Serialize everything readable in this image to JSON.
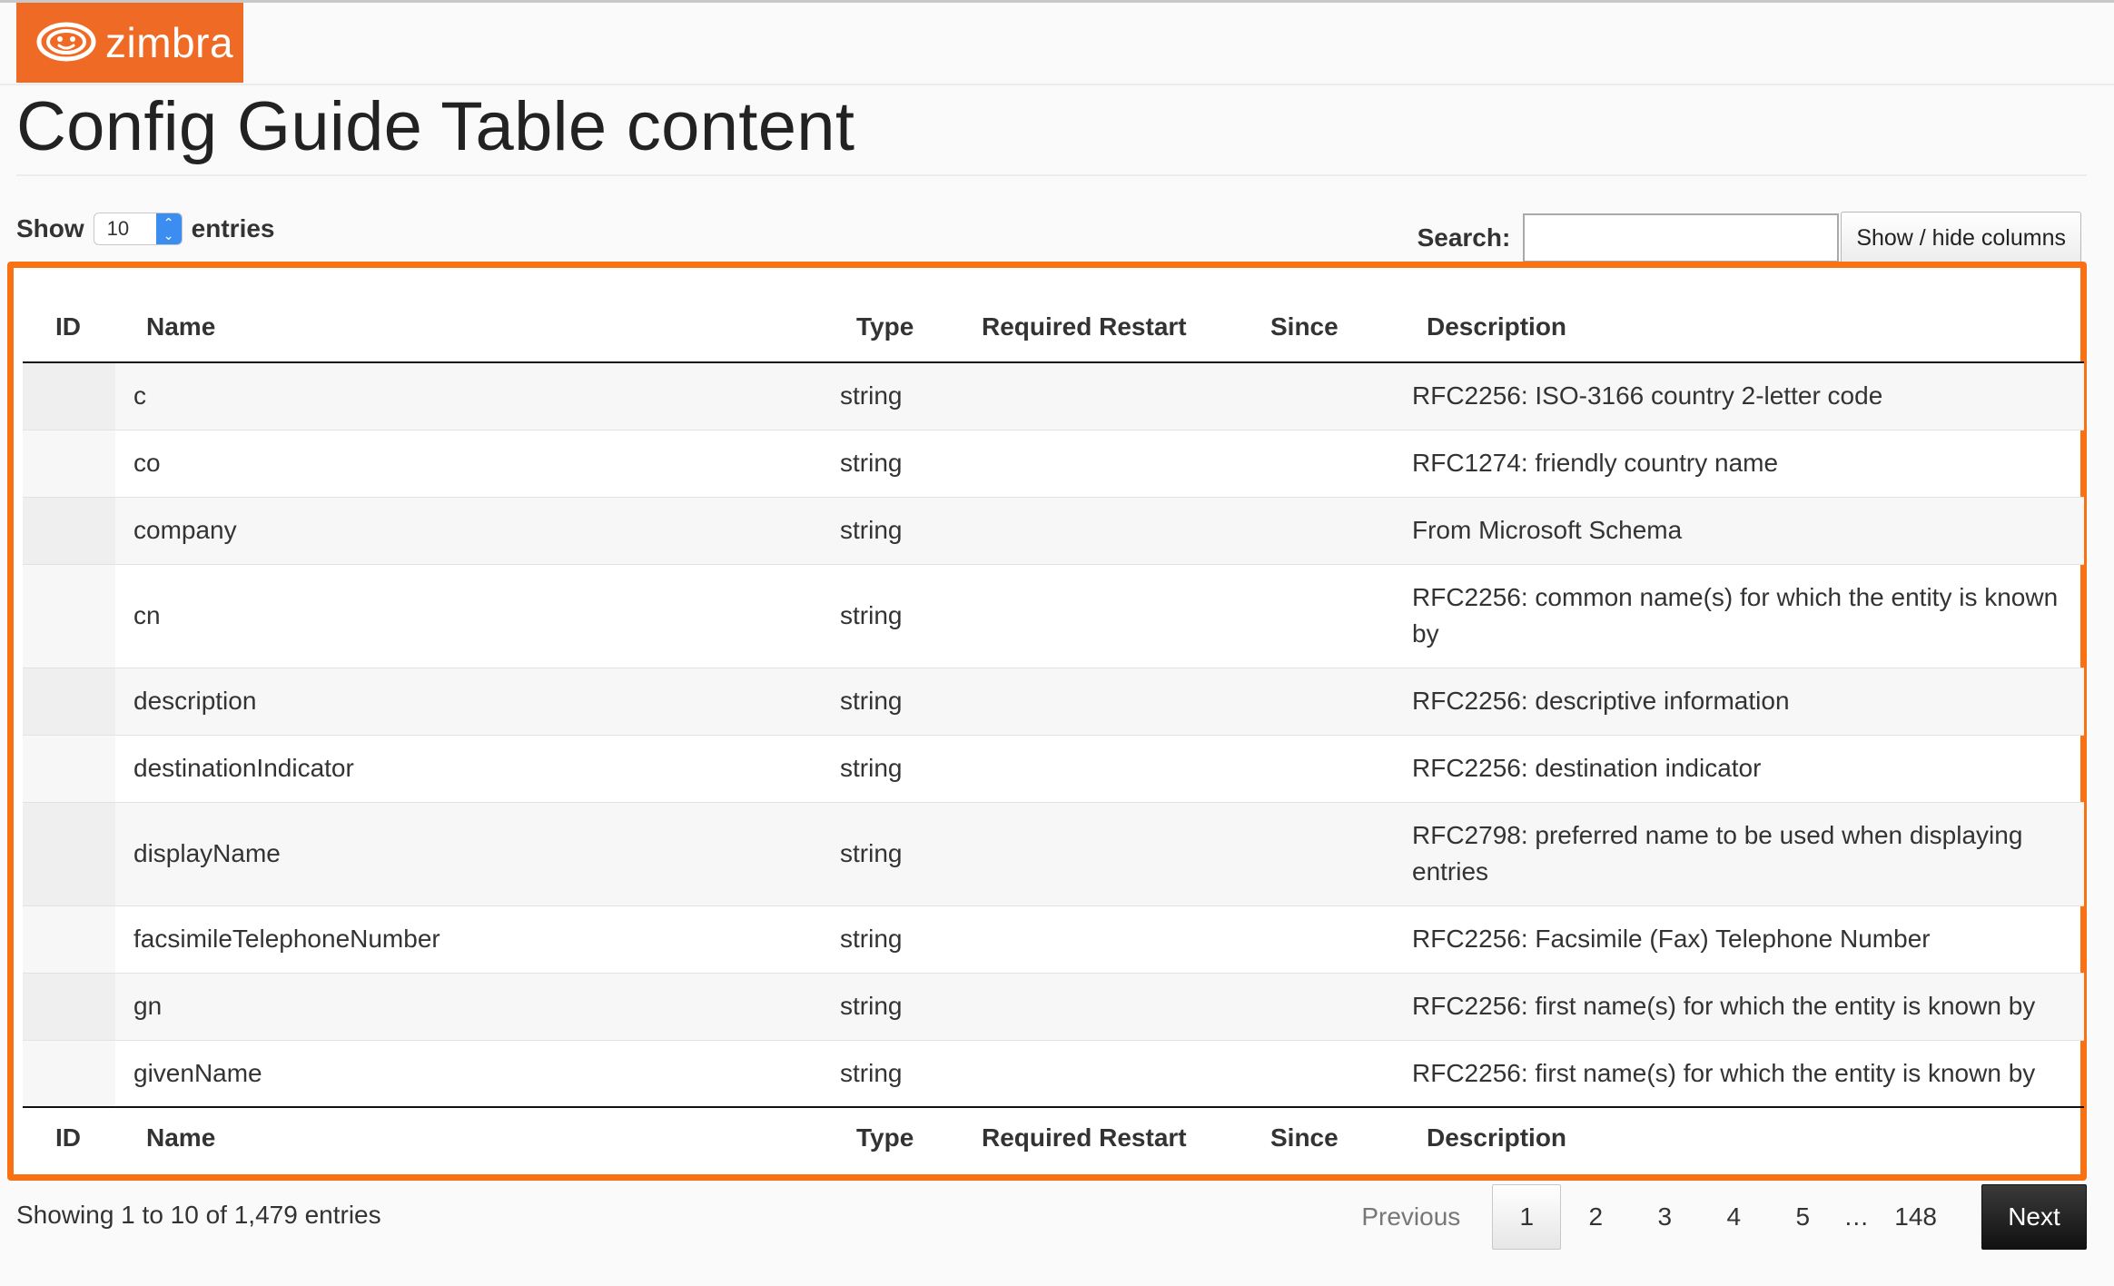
{
  "brand": {
    "logo_text": "zimbra",
    "color": "#ef6a24"
  },
  "page": {
    "title": "Config Guide Table content"
  },
  "controls": {
    "show_label": "Show",
    "page_length": "10",
    "entries_label": "entries",
    "search_label": "Search:",
    "search_value": "",
    "colvis_label": "Show / hide columns"
  },
  "table": {
    "columns": [
      "ID",
      "Name",
      "Type",
      "Required Restart",
      "Since",
      "Description"
    ],
    "rows": [
      {
        "id": "",
        "name": "c",
        "type": "string",
        "restart": "",
        "since": "",
        "description": "RFC2256: ISO-3166 country 2-letter code"
      },
      {
        "id": "",
        "name": "co",
        "type": "string",
        "restart": "",
        "since": "",
        "description": "RFC1274: friendly country name"
      },
      {
        "id": "",
        "name": "company",
        "type": "string",
        "restart": "",
        "since": "",
        "description": "From Microsoft Schema"
      },
      {
        "id": "",
        "name": "cn",
        "type": "string",
        "restart": "",
        "since": "",
        "description": "RFC2256: common name(s) for which the entity is known by"
      },
      {
        "id": "",
        "name": "description",
        "type": "string",
        "restart": "",
        "since": "",
        "description": "RFC2256: descriptive information"
      },
      {
        "id": "",
        "name": "destinationIndicator",
        "type": "string",
        "restart": "",
        "since": "",
        "description": "RFC2256: destination indicator"
      },
      {
        "id": "",
        "name": "displayName",
        "type": "string",
        "restart": "",
        "since": "",
        "description": "RFC2798: preferred name to be used when displaying entries"
      },
      {
        "id": "",
        "name": "facsimileTelephoneNumber",
        "type": "string",
        "restart": "",
        "since": "",
        "description": "RFC2256: Facsimile (Fax) Telephone Number"
      },
      {
        "id": "",
        "name": "gn",
        "type": "string",
        "restart": "",
        "since": "",
        "description": "RFC2256: first name(s) for which the entity is known by"
      },
      {
        "id": "",
        "name": "givenName",
        "type": "string",
        "restart": "",
        "since": "",
        "description": "RFC2256: first name(s) for which the entity is known by"
      }
    ]
  },
  "info": {
    "text": "Showing 1 to 10 of 1,479 entries"
  },
  "pagination": {
    "previous": "Previous",
    "pages": [
      "1",
      "2",
      "3",
      "4",
      "5"
    ],
    "ellipsis": "…",
    "last": "148",
    "next": "Next",
    "current": "1"
  },
  "colors": {
    "highlight_frame": "#fa7114",
    "next_button": "#1a1a1a"
  }
}
